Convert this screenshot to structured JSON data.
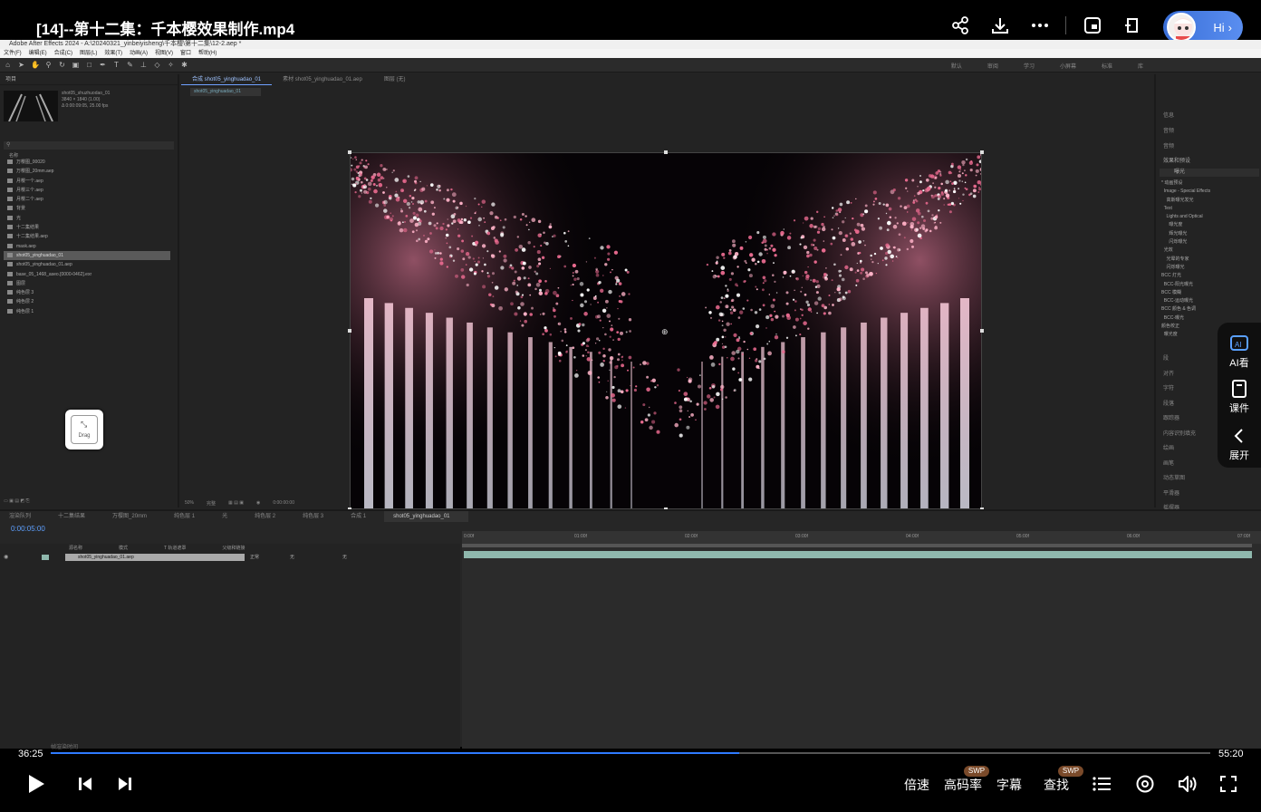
{
  "player": {
    "title": "[14]--第十二集：千本樱效果制作.mp4",
    "hi_label": "Hi",
    "current_time": "36:25",
    "duration": "55:20",
    "progress_fraction": 0.594,
    "controls": {
      "speed": "倍速",
      "bitrate": "高码率",
      "subtitle": "字幕",
      "search": "查找",
      "swp_badge": "SWP"
    }
  },
  "side_widget": {
    "ai_label": "AI看",
    "courseware_label": "课件",
    "expand_label": "展开"
  },
  "ae": {
    "window_title": "Adobe After Effects 2024 - A:\\20240321_yinbeiyisheng\\千本樱\\第十二集\\12-2.aep *",
    "menu": [
      "文件(F)",
      "编辑(E)",
      "合成(C)",
      "图层(L)",
      "效果(T)",
      "动画(A)",
      "视图(V)",
      "窗口",
      "帮助(H)"
    ],
    "workspaces": [
      "默认",
      "审阅",
      "学习",
      "小屏幕",
      "标准",
      "库"
    ],
    "project": {
      "tab": "项目",
      "meta_name": "shot05_shuzhuodao_01",
      "meta_dims": "3840 × 1840 (1.00)",
      "meta_dur": "Δ 0:00:09:05, 25.00 fps",
      "search_placeholder": "",
      "column": "名称",
      "items": [
        "万樱图_00020",
        "万樱图_20mm.aep",
        "月樱一个.aep",
        "月樱三个.aep",
        "月樱二个.aep",
        "背景",
        "光",
        "十二集结果",
        "十二集结果.aep",
        "mask.aep",
        "shot05_yinghuadao_01",
        "shot05_yinghuadao_01.aep",
        "base_05_1468_aseo.[0000-0462].exr",
        "图层",
        "纯色层 3",
        "纯色层 2",
        "纯色层 1"
      ],
      "selected_index": 10,
      "drag_label": "Drag"
    },
    "viewer": {
      "tabs": [
        "合成 shot05_yinghuadao_01",
        "素材 shot05_yinghuadao_01.aep",
        "图层 (无)"
      ],
      "active_tab": 0,
      "sub_tab": "shot05_yinghuadao_01",
      "zoom": "50%",
      "quality": "完整",
      "timecode": "0:00:00:00"
    },
    "effects": {
      "headers": [
        "信息",
        "音频",
        "音频"
      ],
      "panel_title": "效果和预设",
      "search_value": "曝光",
      "tree": [
        "* 动画预设",
        "  Image - Special Effects",
        "    高斯曝光发光",
        "  Text",
        "    Lights and Optical",
        "      曝光度",
        "      辉光曝光",
        "      闪烁曝光",
        "  光效",
        "    光晕的专家",
        "    闪烁曝光",
        "BCC 灯光",
        "  BCC-阳光曝光",
        "BCC 模糊",
        "  BCC-运动曝光",
        "BCC 颜色 & 色调",
        "  BCC-曝光",
        "颜色校正",
        "  曝光度"
      ],
      "lower": [
        "段",
        "对齐",
        "字符",
        "段落",
        "跟踪器",
        "内容识别填充",
        "绘画",
        "画笔",
        "动态草图",
        "平滑器",
        "摇摆器",
        "蒙板插值"
      ]
    },
    "timeline": {
      "tabs": [
        "渲染队列",
        "十二集结果",
        "万樱图_20mm",
        "纯色层 1",
        "光",
        "纯色层 2",
        "纯色层 3",
        "合成 1",
        "shot05_yinghuadao_01"
      ],
      "active_tab": 8,
      "timecode": "0:00:05:00",
      "columns": [
        "源名称",
        "模式",
        "T 轨道遮罩",
        "父级和链接"
      ],
      "layer_name": "shot05_yinghuadao_01.aep",
      "layer_mode": "正常",
      "layer_matte": "无",
      "layer_parent": "无",
      "ruler": [
        "0:00f",
        "01:00f",
        "02:00f",
        "03:00f",
        "04:00f",
        "05:00f",
        "06:00f",
        "07:00f"
      ],
      "footer": "帧渲染时间"
    }
  }
}
